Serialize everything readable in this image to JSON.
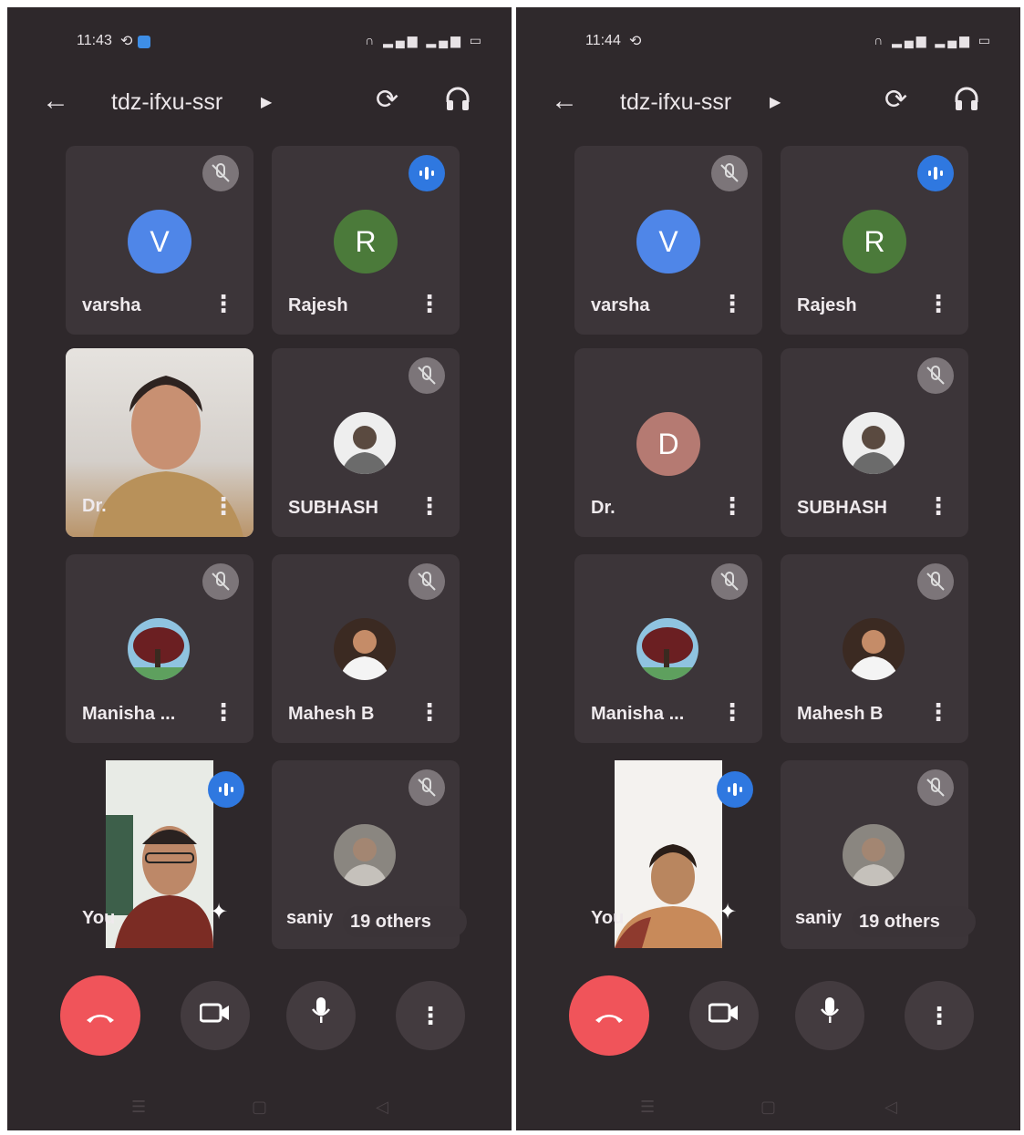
{
  "screens": [
    {
      "status": {
        "time": "11:43"
      },
      "meeting": {
        "title": "tdz-ifxu-ssr"
      },
      "tiles": [
        {
          "name": "varsha",
          "initial": "V",
          "color": "#4f86e8"
        },
        {
          "name": "Rajesh",
          "initial": "R",
          "color": "#4b7a3a"
        },
        {
          "name": "Dr."
        },
        {
          "name": "SUBHASH"
        },
        {
          "name": "Manisha ..."
        },
        {
          "name": "Mahesh B"
        }
      ],
      "self": {
        "label": "You"
      },
      "others": {
        "name_fragment": "saniy",
        "label": "19 others"
      }
    },
    {
      "status": {
        "time": "11:44"
      },
      "meeting": {
        "title": "tdz-ifxu-ssr"
      },
      "tiles": [
        {
          "name": "varsha",
          "initial": "V",
          "color": "#4f86e8"
        },
        {
          "name": "Rajesh",
          "initial": "R",
          "color": "#4b7a3a"
        },
        {
          "name": "Dr.",
          "initial": "D",
          "color": "#b57a72"
        },
        {
          "name": "SUBHASH"
        },
        {
          "name": "Manisha ..."
        },
        {
          "name": "Mahesh B"
        }
      ],
      "self": {
        "label": "You"
      },
      "others": {
        "name_fragment": "saniy",
        "label": "19 others"
      }
    }
  ],
  "icons": {
    "back": "arrow-left-icon",
    "switch_camera": "switch-camera-icon",
    "audio": "headphones-icon",
    "muted": "mic-off-icon",
    "speaking": "speaking-indicator-icon",
    "end_call": "phone-hangup-icon",
    "camera": "video-camera-icon",
    "mic": "microphone-icon",
    "more": "more-vert-icon",
    "effects": "sparkle-icon"
  }
}
